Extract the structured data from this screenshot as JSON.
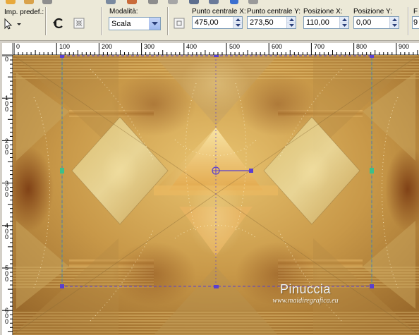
{
  "toolbar": {
    "preset_label": "Imp. predef.:",
    "mode": {
      "label": "Modalità:",
      "value": "Scala"
    },
    "center_x": {
      "label": "Punto centrale X:",
      "value": "475,00"
    },
    "center_y": {
      "label": "Punto centrale Y:",
      "value": "273,50"
    },
    "pos_x": {
      "label": "Posizione X:",
      "value": "110,00"
    },
    "pos_y": {
      "label": "Posizione Y:",
      "value": "0,00"
    },
    "cut_label": "F",
    "cut_value": "9"
  },
  "ruler": {
    "h_ticks": [
      "0",
      "100",
      "200",
      "300",
      "400",
      "500",
      "600",
      "700",
      "800",
      "900"
    ],
    "v_ticks": [
      "0",
      "100",
      "200",
      "300",
      "400",
      "500",
      "600"
    ]
  },
  "watermark": {
    "name": "Pinuccia",
    "site": "www.maidiregrafica.eu"
  },
  "colors": {
    "selection": "#5a3fcf",
    "side_handle": "#3cc08a",
    "accent_blue": "#3a6fd0"
  },
  "icons": [
    "pick-tool-icon",
    "dropdown-arrow-icon",
    "rotate-icon",
    "reset-icon",
    "center-icon"
  ]
}
